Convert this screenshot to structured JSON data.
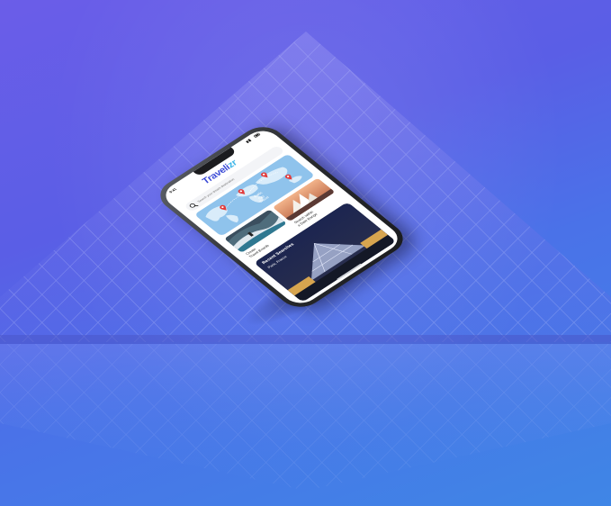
{
  "status": {
    "time": "9:41"
  },
  "app": {
    "brand_main": "Traveli",
    "brand_accent": "zr"
  },
  "search": {
    "placeholder": "Search your dream destination"
  },
  "map": {
    "label_line1": "Baltic",
    "label_line2": "City",
    "label_line3": "Travel"
  },
  "tiles": [
    {
      "caption_line1": "Create",
      "caption_line2": "Travel Boards"
    },
    {
      "caption_line1": "Search within",
      "caption_line2": "a Date Range"
    }
  ],
  "recent": {
    "title": "Recent Searches",
    "place": "Paris, France"
  },
  "colors": {
    "brand": "#3a4ad6",
    "brand_accent": "#3fb6e8",
    "bg_start": "#6b5de8",
    "bg_end": "#3f86e6",
    "pin": "#e23b3b"
  }
}
